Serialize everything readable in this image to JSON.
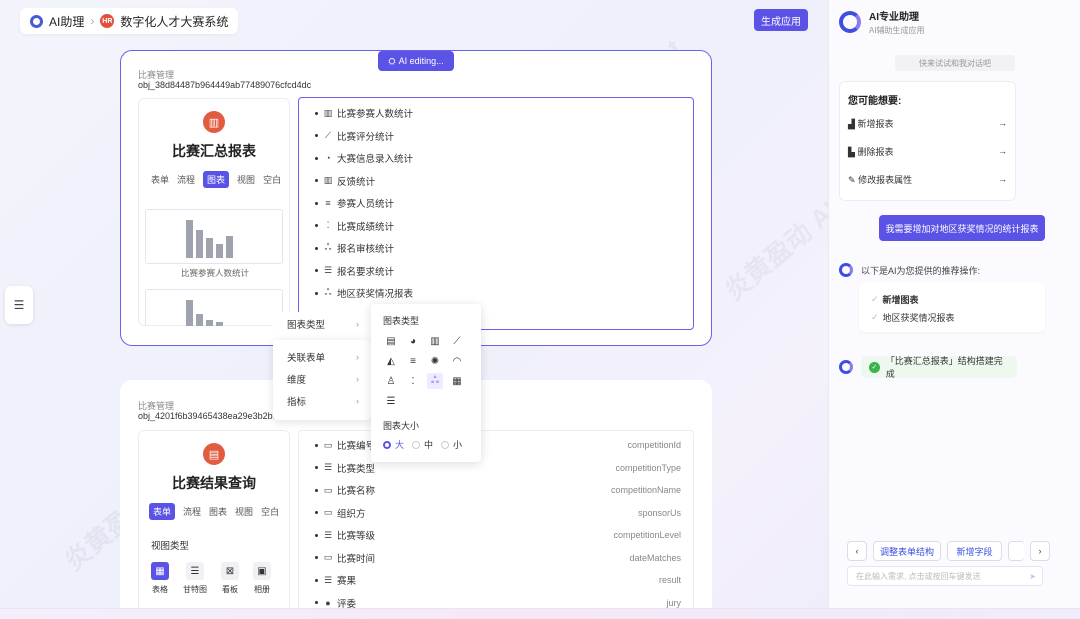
{
  "breadcrumb": {
    "root": "AI助理",
    "badge": "HR",
    "current": "数字化人才大赛系统"
  },
  "header": {
    "generate_button": "生成应用"
  },
  "card1": {
    "ai_editing": "AI editing...",
    "label": "比赛管理",
    "obj_id": "obj_38d84487b964449ab77489076cfcd4dc",
    "title": "比赛汇总报表",
    "tabs": [
      "表单",
      "流程",
      "图表",
      "视图",
      "空白"
    ],
    "active_tab": "图表",
    "preview_caption": "比赛参赛人数统计",
    "items": [
      {
        "icon": "bar-chart-icon",
        "label": "比赛参赛人数统计"
      },
      {
        "icon": "line-chart-icon",
        "label": "比赛评分统计"
      },
      {
        "icon": "gauge-icon",
        "label": "大赛信息录入统计"
      },
      {
        "icon": "bar-chart-icon",
        "label": "反馈统计"
      },
      {
        "icon": "funnel-icon",
        "label": "参赛人员统计"
      },
      {
        "icon": "scatter-icon",
        "label": "比赛成绩统计"
      },
      {
        "icon": "bubble-icon",
        "label": "报名审核统计"
      },
      {
        "icon": "stack-icon",
        "label": "报名要求统计"
      },
      {
        "icon": "bubble-icon",
        "label": "地区获奖情况报表"
      }
    ]
  },
  "context_menu": {
    "items": [
      {
        "label": "图表类型"
      },
      {
        "label": "关联表单"
      },
      {
        "label": "维度"
      },
      {
        "label": "指标"
      }
    ],
    "submenu": {
      "title": "图表类型",
      "size_title": "图表大小",
      "sizes": [
        "大",
        "中",
        "小"
      ],
      "selected_size": "大"
    }
  },
  "card2": {
    "label": "比赛管理",
    "obj_id": "obj_4201f6b39465438ea29e3b2b9",
    "title": "比赛结果查询",
    "tabs": [
      "表单",
      "流程",
      "图表",
      "视图",
      "空白"
    ],
    "active_tab": "表单",
    "view_type_label": "视图类型",
    "view_types": [
      "表格",
      "甘特图",
      "看板",
      "相册"
    ],
    "fields": [
      {
        "label": "比赛编号",
        "key": "competitionId"
      },
      {
        "label": "比赛类型",
        "key": "competitionType"
      },
      {
        "label": "比赛名称",
        "key": "competitionName"
      },
      {
        "label": "组织方",
        "key": "sponsorUs"
      },
      {
        "label": "比赛等级",
        "key": "competitionLevel"
      },
      {
        "label": "比赛时间",
        "key": "dateMatches"
      },
      {
        "label": "赛果",
        "key": "result"
      },
      {
        "label": "评委",
        "key": "jury"
      }
    ]
  },
  "assistant": {
    "title": "AI专业助理",
    "subtitle": "AI辅助生成应用",
    "hint": "快来试试和我对话吧",
    "suggest_title": "您可能想要:",
    "suggestions": [
      {
        "icon": "add-report-icon",
        "label": "新增报表"
      },
      {
        "icon": "delete-report-icon",
        "label": "删除报表"
      },
      {
        "icon": "edit-icon",
        "label": "修改报表属性"
      }
    ],
    "user_message": "我需要增加对地区获奖情况的统计报表",
    "reply_intro": "以下是AI为您提供的推荐操作:",
    "recommendations": [
      "新增图表",
      "地区获奖情况报表"
    ],
    "done_message": "「比赛汇总报表」结构搭建完成",
    "quick_actions": [
      "调整表单结构",
      "新增字段"
    ],
    "input_placeholder": "在此输入需求, 点击或按回车键发送"
  },
  "watermark_text": "炎黄盈动 AI Copilot"
}
